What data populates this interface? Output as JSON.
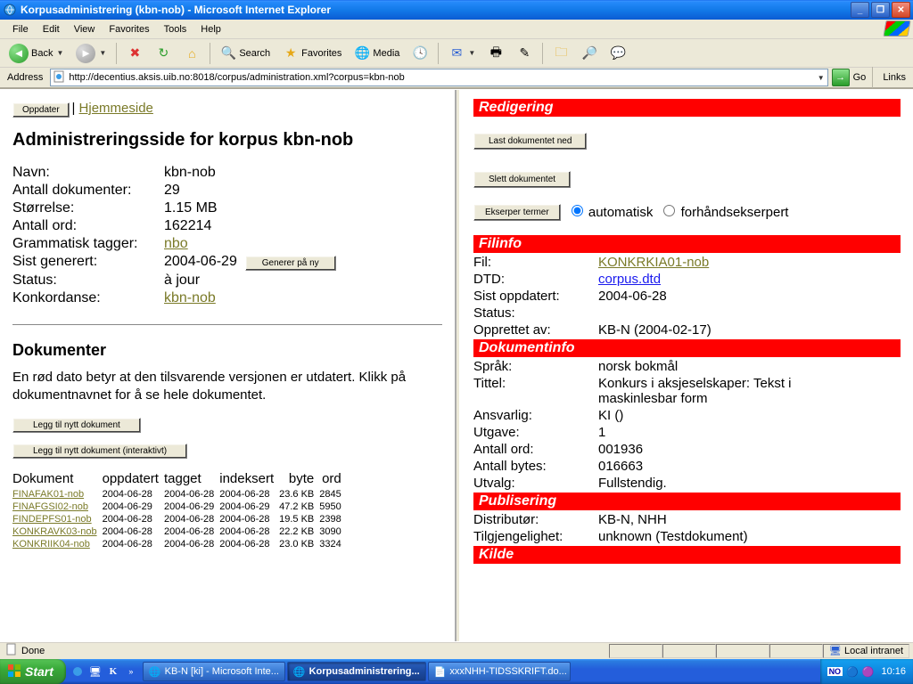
{
  "window": {
    "title": "Korpusadministrering (kbn-nob) - Microsoft Internet Explorer"
  },
  "menu": {
    "file": "File",
    "edit": "Edit",
    "view": "View",
    "favorites": "Favorites",
    "tools": "Tools",
    "help": "Help"
  },
  "toolbar": {
    "back": "Back",
    "search": "Search",
    "favorites": "Favorites",
    "media": "Media"
  },
  "address": {
    "label": "Address",
    "url": "http://decentius.aksis.uib.no:8018/corpus/administration.xml?corpus=kbn-nob",
    "go": "Go",
    "links": "Links"
  },
  "left": {
    "oppdater": "Oppdater",
    "hjemmeside": "Hjemmeside",
    "heading": "Administreringsside for korpus kbn-nob",
    "info": {
      "navn_label": "Navn:",
      "navn": "kbn-nob",
      "antdoc_label": "Antall dokumenter:",
      "antdoc": "29",
      "storrelse_label": "Størrelse:",
      "storrelse": "1.15 MB",
      "antord_label": "Antall ord:",
      "antord": "162214",
      "gramtag_label": "Grammatisk tagger:",
      "gramtag": "nbo",
      "sistgen_label": "Sist generert:",
      "sistgen": "2004-06-29",
      "generer_btn": "Generer på ny",
      "status_label": "Status:",
      "status": "à jour",
      "konkordanse_label": "Konkordanse:",
      "konkordanse": "kbn-nob"
    },
    "dokumenter": {
      "heading": "Dokumenter",
      "note": "En rød dato betyr at den tilsvarende versjonen er utdatert. Klikk på dokumentnavnet for å se hele dokumentet.",
      "legg_til": "Legg til nytt dokument",
      "legg_til_interaktivt": "Legg til nytt dokument (interaktivt)",
      "cols": {
        "doc": "Dokument",
        "oppdatert": "oppdatert",
        "tagget": "tagget",
        "indeksert": "indeksert",
        "byte": "byte",
        "ord": "ord"
      },
      "rows": [
        {
          "doc": "FINAFAK01-nob",
          "oppdatert": "2004-06-28",
          "tagget": "2004-06-28",
          "indeksert": "2004-06-28",
          "byte": "23.6 KB",
          "ord": "2845"
        },
        {
          "doc": "FINAFGSI02-nob",
          "oppdatert": "2004-06-29",
          "tagget": "2004-06-29",
          "indeksert": "2004-06-29",
          "byte": "47.2 KB",
          "ord": "5950"
        },
        {
          "doc": "FINDEPFS01-nob",
          "oppdatert": "2004-06-28",
          "tagget": "2004-06-28",
          "indeksert": "2004-06-28",
          "byte": "19.5 KB",
          "ord": "2398"
        },
        {
          "doc": "KONKRAVK03-nob",
          "oppdatert": "2004-06-28",
          "tagget": "2004-06-28",
          "indeksert": "2004-06-28",
          "byte": "22.2 KB",
          "ord": "3090"
        },
        {
          "doc": "KONKRIIK04-nob",
          "oppdatert": "2004-06-28",
          "tagget": "2004-06-28",
          "indeksert": "2004-06-28",
          "byte": "23.0 KB",
          "ord": "3324"
        }
      ]
    }
  },
  "right": {
    "redigering": "Redigering",
    "last_ned": "Last dokumentet ned",
    "slett": "Slett dokumentet",
    "ekserper": "Ekserper termer",
    "automatisk": "automatisk",
    "forhand": "forhåndsekserpert",
    "filinfo": {
      "heading": "Filinfo",
      "fil_label": "Fil:",
      "fil": "KONKRKIA01-nob",
      "dtd_label": "DTD:",
      "dtd": "corpus.dtd",
      "sist_label": "Sist oppdatert:",
      "sist": "2004-06-28",
      "status_label": "Status:",
      "status": "",
      "opprettet_label": "Opprettet av:",
      "opprettet": "KB-N (2004-02-17)"
    },
    "dokumentinfo": {
      "heading": "Dokumentinfo",
      "sprak_label": "Språk:",
      "sprak": "norsk bokmål",
      "tittel_label": "Tittel:",
      "tittel": "Konkurs i aksjeselskaper: Tekst i maskinlesbar form",
      "ansvarlig_label": "Ansvarlig:",
      "ansvarlig": "KI ()",
      "utgave_label": "Utgave:",
      "utgave": "1",
      "antord_label": "Antall ord:",
      "antord": "001936",
      "antbytes_label": "Antall bytes:",
      "antbytes": "016663",
      "utvalg_label": "Utvalg:",
      "utvalg": "Fullstendig."
    },
    "publisering": {
      "heading": "Publisering",
      "distributor_label": "Distributør:",
      "distributor": "KB-N, NHH",
      "tilgjengelighet_label": "Tilgjengelighet:",
      "tilgjengelighet": "unknown (Testdokument)"
    },
    "kilde": {
      "heading": "Kilde"
    }
  },
  "status": {
    "done": "Done",
    "zone": "Local intranet"
  },
  "taskbar": {
    "start": "Start",
    "items": [
      "KB-N [ki] - Microsoft Inte...",
      "Korpusadministrering...",
      "xxxNHH-TIDSSKRIFT.do..."
    ],
    "clock": "10:16"
  }
}
